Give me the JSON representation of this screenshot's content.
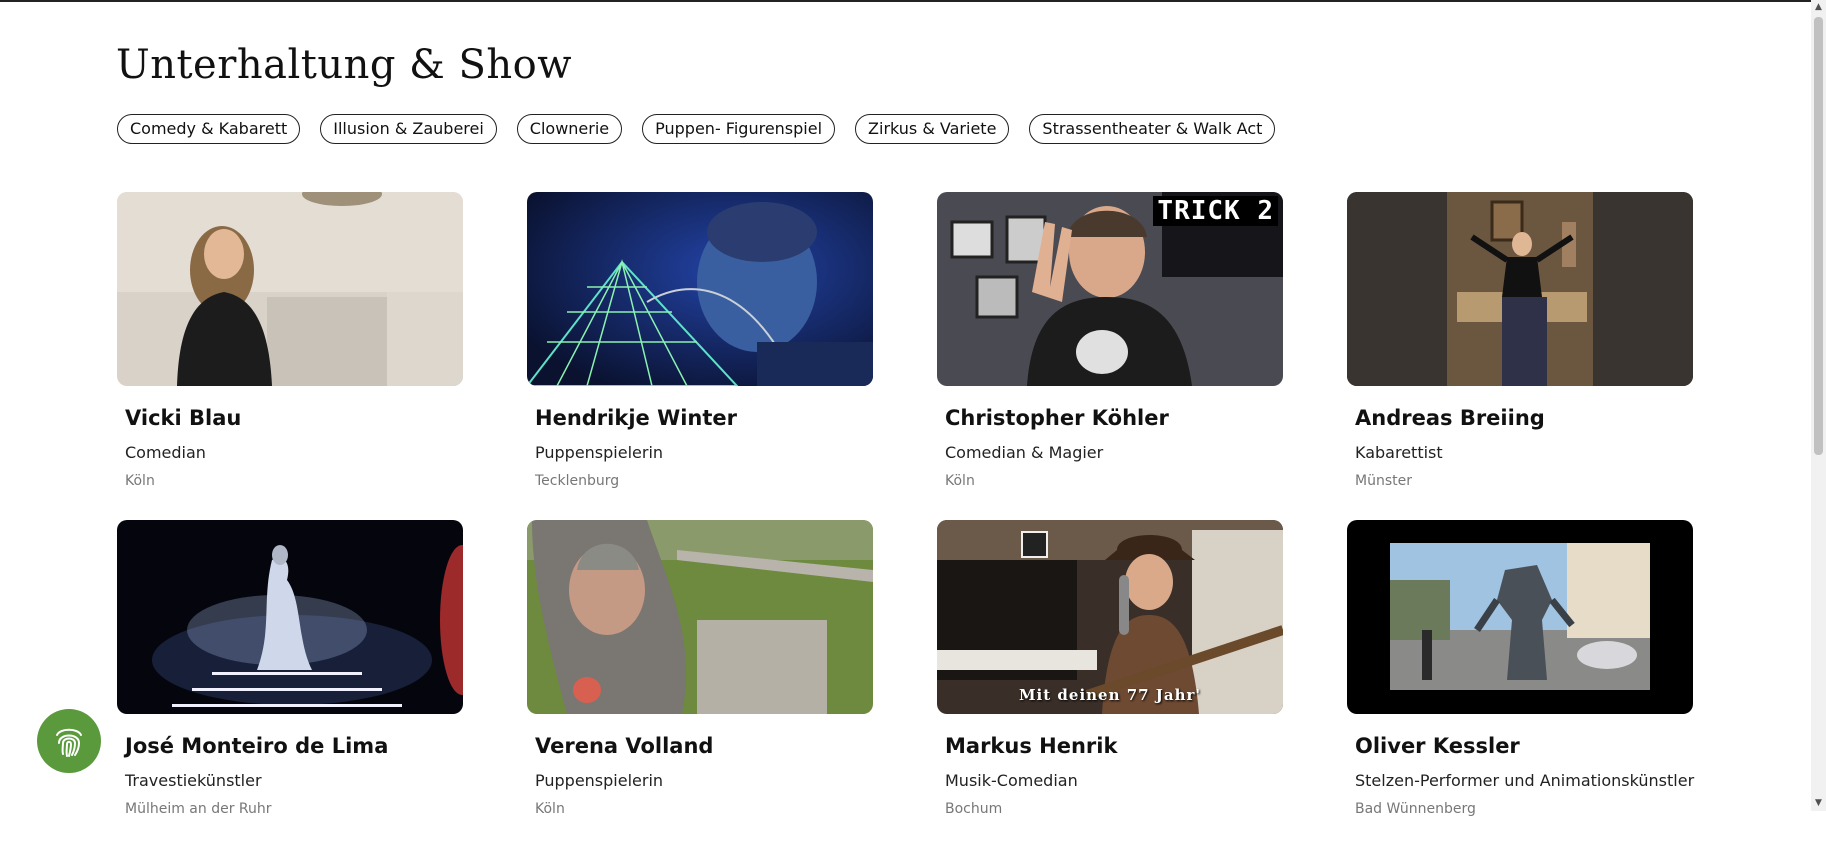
{
  "page": {
    "title": "Unterhaltung & Show"
  },
  "categories": [
    "Comedy & Kabarett",
    "Illusion & Zauberei",
    "Clownerie",
    "Puppen- Figurenspiel",
    "Zirkus & Variete",
    "Strassentheater & Walk Act"
  ],
  "artists": [
    {
      "name": "Vicki Blau",
      "role": "Comedian",
      "city": "Köln"
    },
    {
      "name": "Hendrikje Winter",
      "role": "Puppenspielerin",
      "city": "Tecklenburg"
    },
    {
      "name": "Christopher Köhler",
      "role": "Comedian & Magier",
      "city": "Köln",
      "overlay": "TRICK 2"
    },
    {
      "name": "Andreas Breiing",
      "role": "Kabarettist",
      "city": "Münster"
    },
    {
      "name": "José Monteiro de Lima",
      "role": "Travestiekünstler",
      "city": "Mülheim an der Ruhr"
    },
    {
      "name": "Verena Volland",
      "role": "Puppenspielerin",
      "city": "Köln"
    },
    {
      "name": "Markus Henrik",
      "role": "Musik-Comedian",
      "city": "Bochum",
      "overlay": "Mit deinen 77 Jahr'"
    },
    {
      "name": "Oliver Kessler",
      "role": "Stelzen-Performer und Animationskünstler",
      "city": "Bad Wünnenberg"
    }
  ],
  "colors": {
    "accent_green": "#5a9a3c",
    "chip_border": "#222222"
  },
  "icons": {
    "floating_button": "fingerprint-icon",
    "scroll_up": "chevron-up-icon",
    "scroll_down": "chevron-down-icon"
  }
}
